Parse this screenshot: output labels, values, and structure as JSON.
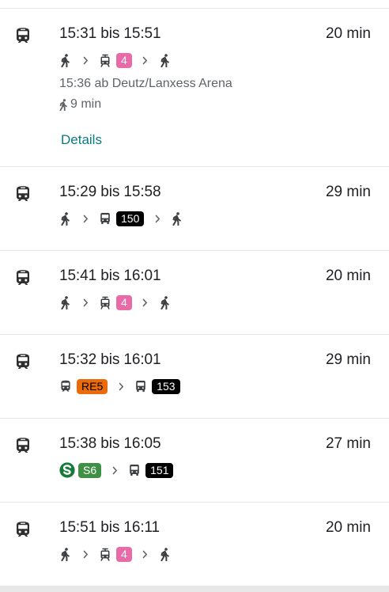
{
  "colors": {
    "tram_badge": "#e86aa7",
    "bus_badge": "#000000",
    "regional_badge": "#eb6a0a",
    "sbahn_badge": "#3f8f45",
    "sbahn_logo": "#187a3a",
    "details_link": "#0b7a84"
  },
  "routes": [
    {
      "times": "15:31 bis 15:51",
      "duration": "20 min",
      "icon": "train-icon",
      "legs": [
        {
          "kind": "walk",
          "icon": "walk-icon"
        },
        {
          "kind": "tram",
          "icon": "tram-icon",
          "line": "4",
          "color": "#e86aa7",
          "text_color": "#ffffff"
        },
        {
          "kind": "walk",
          "icon": "walk-icon"
        }
      ],
      "departure_info": "15:36 ab Deutz/Lanxess Arena",
      "walk_time": "9 min",
      "details_label": "Details"
    },
    {
      "times": "15:29 bis 15:58",
      "duration": "29 min",
      "icon": "train-icon",
      "legs": [
        {
          "kind": "walk",
          "icon": "walk-icon"
        },
        {
          "kind": "bus",
          "icon": "bus-icon",
          "line": "150",
          "color": "#000000",
          "text_color": "#ffffff"
        },
        {
          "kind": "walk",
          "icon": "walk-icon"
        }
      ]
    },
    {
      "times": "15:41 bis 16:01",
      "duration": "20 min",
      "icon": "train-icon",
      "legs": [
        {
          "kind": "walk",
          "icon": "walk-icon"
        },
        {
          "kind": "tram",
          "icon": "tram-icon",
          "line": "4",
          "color": "#e86aa7",
          "text_color": "#ffffff"
        },
        {
          "kind": "walk",
          "icon": "walk-icon"
        }
      ]
    },
    {
      "times": "15:32 bis 16:01",
      "duration": "29 min",
      "icon": "train-icon",
      "legs": [
        {
          "kind": "train",
          "icon": "train-icon",
          "line": "RE5",
          "color": "#eb6a0a",
          "text_color": "#000000"
        },
        {
          "kind": "bus",
          "icon": "bus-icon",
          "line": "153",
          "color": "#000000",
          "text_color": "#ffffff"
        }
      ]
    },
    {
      "times": "15:38 bis 16:05",
      "duration": "27 min",
      "icon": "train-icon",
      "legs": [
        {
          "kind": "sbahn",
          "icon": "sbahn-logo-icon",
          "line": "S6",
          "color": "#3f8f45",
          "text_color": "#ffffff"
        },
        {
          "kind": "bus",
          "icon": "bus-icon",
          "line": "151",
          "color": "#000000",
          "text_color": "#ffffff"
        }
      ]
    },
    {
      "times": "15:51 bis 16:11",
      "duration": "20 min",
      "icon": "train-icon",
      "legs": [
        {
          "kind": "walk",
          "icon": "walk-icon"
        },
        {
          "kind": "tram",
          "icon": "tram-icon",
          "line": "4",
          "color": "#e86aa7",
          "text_color": "#ffffff"
        },
        {
          "kind": "walk",
          "icon": "walk-icon"
        }
      ]
    }
  ]
}
